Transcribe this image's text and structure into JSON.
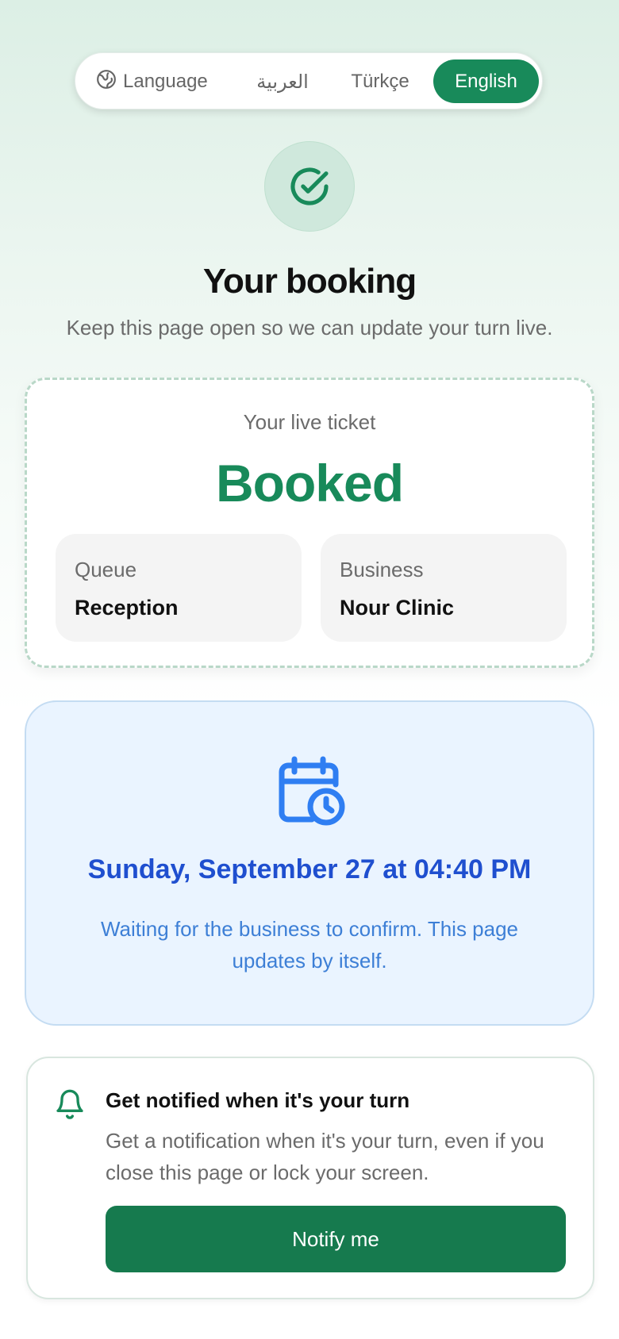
{
  "language_bar": {
    "label": "Language",
    "options": [
      "العربية",
      "Türkçe",
      "English"
    ],
    "selected": "English",
    "icon": "globe-icon"
  },
  "header": {
    "icon": "check-circle-icon",
    "title": "Your booking",
    "subtitle": "Keep this page open so we can update your turn live."
  },
  "ticket": {
    "label": "Your live ticket",
    "status": "Booked",
    "queue_label": "Queue",
    "queue_value": "Reception",
    "business_label": "Business",
    "business_value": "Nour Clinic"
  },
  "schedule": {
    "icon": "calendar-clock-icon",
    "datetime": "Sunday, September 27 at 04:40 PM",
    "note": "Waiting for the business to confirm. This page updates by itself."
  },
  "notify": {
    "icon": "bell-icon",
    "title": "Get notified when it's your turn",
    "description": "Get a notification when it's your turn, even if you close this page or lock your screen.",
    "button_label": "Notify me"
  },
  "colors": {
    "primary_green": "#188a5a",
    "button_green": "#167a4e",
    "blue_text": "#1f4fcf",
    "blue_bg": "#eaf4ff"
  }
}
